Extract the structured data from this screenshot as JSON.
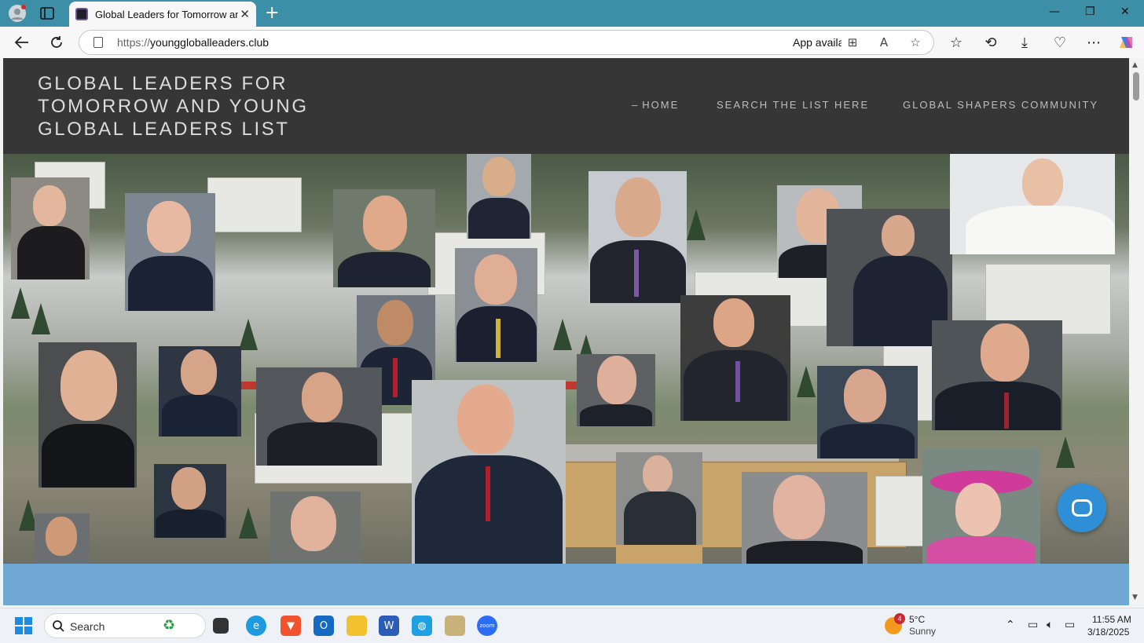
{
  "browser": {
    "tab_title": "Global Leaders for Tomorrow and",
    "url_scheme": "https://",
    "url_host": "younggloballeaders.club",
    "app_available": "App availa"
  },
  "site": {
    "title": "GLOBAL LEADERS FOR TOMORROW AND YOUNG GLOBAL LEADERS LIST",
    "menu": [
      {
        "label": "HOME"
      },
      {
        "label": "SEARCH THE LIST HERE"
      },
      {
        "label": "GLOBAL SHAPERS COMMUNITY"
      }
    ],
    "colors": {
      "header_bg": "#363636",
      "footer_band": "#6fa8d3",
      "chat_button": "#2f8fd6",
      "tab_strip": "#3c8fa6"
    }
  },
  "taskbar": {
    "search_label": "Search",
    "weather_badge": "4",
    "weather_temp": "5°C",
    "weather_desc": "Sunny",
    "time": "11:55 AM",
    "date": "3/18/2025"
  }
}
